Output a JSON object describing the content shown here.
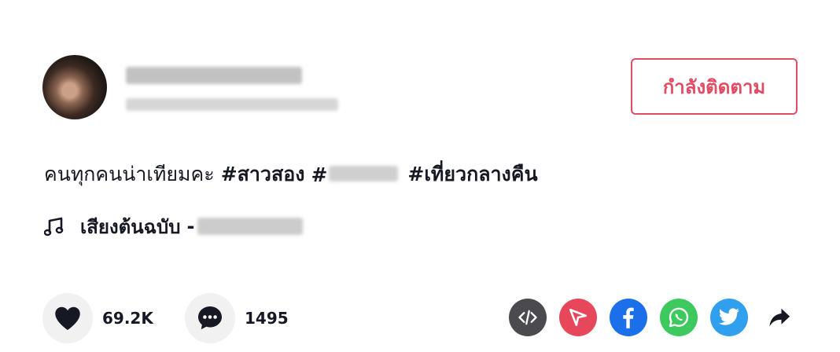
{
  "post": {
    "follow_label": "กำลังติดตาม",
    "caption": {
      "text": "คนทุกคนน่าเทียมคะ",
      "hashtags": [
        "#สาวสอง",
        "#",
        "#เที่ยวกลางคืน"
      ]
    },
    "music": {
      "title": "เสียงต้นฉบับ",
      "separator": "-"
    }
  },
  "actions": {
    "likes": "69.2K",
    "comments": "1495"
  },
  "share": {
    "icons": [
      "embed-icon",
      "send-icon",
      "facebook-icon",
      "whatsapp-icon",
      "twitter-icon",
      "share-arrow-icon"
    ],
    "colors": {
      "embed": "#4a4a4f",
      "send": "#e6475b",
      "facebook": "#1b6fe8",
      "whatsapp": "#3ec95f",
      "twitter": "#2f9fee",
      "accent": "#e14b63"
    }
  }
}
